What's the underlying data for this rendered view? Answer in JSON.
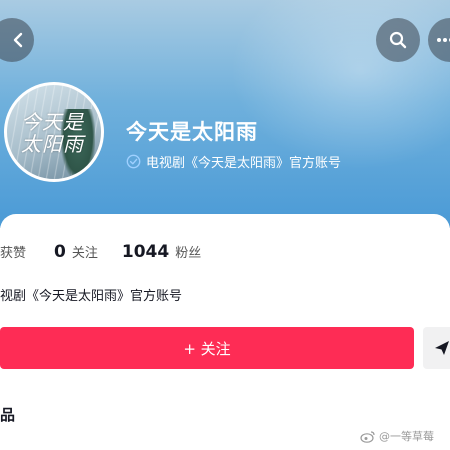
{
  "profile": {
    "name": "今天是太阳雨",
    "verification": "电视剧《今天是太阳雨》官方账号",
    "avatar_logo_text": "今天是太阳雨"
  },
  "stats": {
    "likes_label": "获赞",
    "following_count": "0",
    "following_label": "关注",
    "followers_count": "1044",
    "followers_label": "粉丝"
  },
  "bio": "视剧《今天是太阳雨》官方账号",
  "actions": {
    "follow_label": "+ 关注"
  },
  "tabs": {
    "works": "品"
  },
  "watermark": "@一等草莓",
  "colors": {
    "accent": "#fe2c55",
    "header_blue": "#4a9ad6",
    "verified": "#9fd0ff"
  },
  "icons": [
    "back-icon",
    "search-icon",
    "more-icon",
    "verified-icon",
    "share-icon",
    "weibo-icon"
  ]
}
